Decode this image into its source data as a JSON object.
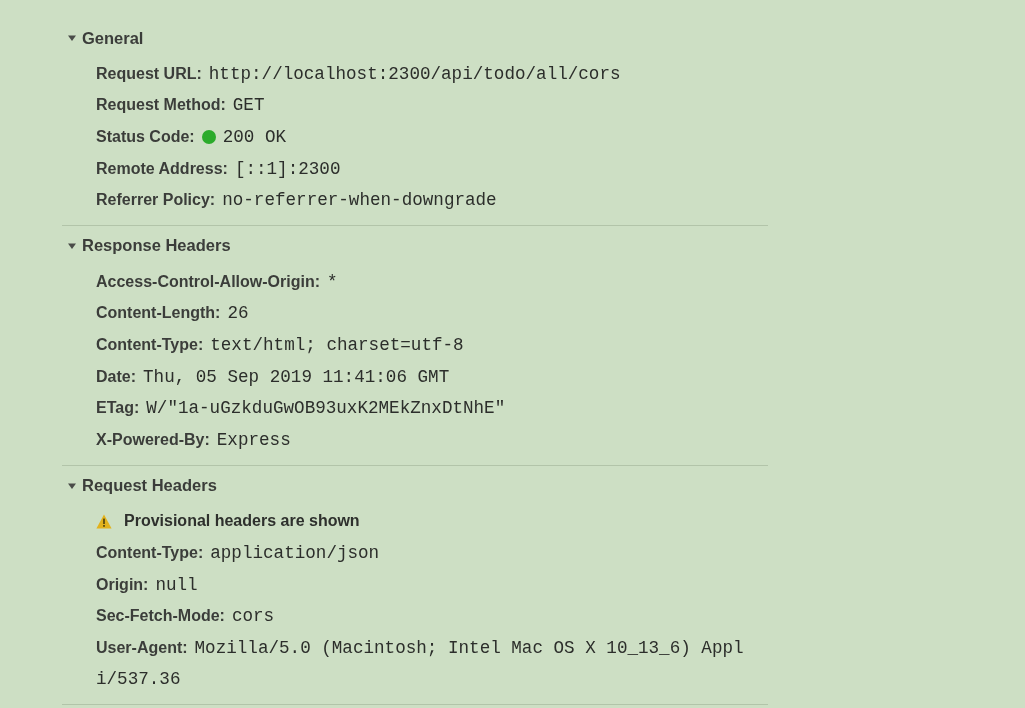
{
  "sections": [
    {
      "title": "General",
      "expanded": true,
      "rows": [
        {
          "kind": "field",
          "name": "Request URL:",
          "value": "http://localhost:2300/api/todo/all/cors"
        },
        {
          "kind": "field",
          "name": "Request Method:",
          "value": "GET"
        },
        {
          "kind": "status",
          "name": "Status Code:",
          "value": "200 OK",
          "color": "#2bab2b"
        },
        {
          "kind": "field",
          "name": "Remote Address:",
          "value": "[::1]:2300"
        },
        {
          "kind": "field",
          "name": "Referrer Policy:",
          "value": "no-referrer-when-downgrade"
        }
      ]
    },
    {
      "title": "Response Headers",
      "expanded": true,
      "rows": [
        {
          "kind": "field",
          "name": "Access-Control-Allow-Origin:",
          "value": "*"
        },
        {
          "kind": "field",
          "name": "Content-Length:",
          "value": "26"
        },
        {
          "kind": "field",
          "name": "Content-Type:",
          "value": "text/html; charset=utf-8"
        },
        {
          "kind": "field",
          "name": "Date:",
          "value": "Thu, 05 Sep 2019 11:41:06 GMT"
        },
        {
          "kind": "field",
          "name": "ETag:",
          "value": "W/\"1a-uGzkduGwOB93uxK2MEkZnxDtNhE\""
        },
        {
          "kind": "field",
          "name": "X-Powered-By:",
          "value": "Express"
        }
      ]
    },
    {
      "title": "Request Headers",
      "expanded": true,
      "rows": [
        {
          "kind": "warning",
          "text": "Provisional headers are shown"
        },
        {
          "kind": "field",
          "name": "Content-Type:",
          "value": "application/json"
        },
        {
          "kind": "field",
          "name": "Origin:",
          "value": "null"
        },
        {
          "kind": "field",
          "name": "Sec-Fetch-Mode:",
          "value": "cors"
        },
        {
          "kind": "wrapped",
          "name": "User-Agent:",
          "value_lines": [
            "Mozilla/5.0 (Macintosh; Intel Mac OS X 10_13_6) Appl",
            "i/537.36"
          ]
        }
      ]
    }
  ]
}
